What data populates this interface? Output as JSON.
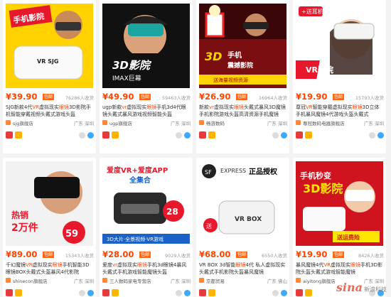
{
  "products": [
    {
      "price": "¥39.90",
      "badge": "包邮",
      "sales": "76286人收货",
      "title_pre": "SJG新款4代",
      "title_hl": "VR",
      "title_mid": "虚拟现实",
      "title_hl2": "眼镜",
      "title_post": "3D影院手机智能穿戴视频头戴式游戏头盔",
      "shop": "sjg旗舰店",
      "location": "广东 深圳",
      "thumb_text": "手机秘密影院",
      "thumb_brand": "VR SJG"
    },
    {
      "price": "¥49.90",
      "badge": "包邮",
      "sales": "59463人收货",
      "title_pre": "ugp新款",
      "title_hl": "vr",
      "title_mid": "虚拟现实",
      "title_hl2": "眼镜",
      "title_post": "手机3d4代眼镜头戴式暴风游戏视频智能头盔",
      "shop": "ugp旗舰店",
      "location": "广东 深圳",
      "thumb_text": "3D影院",
      "thumb_brand": "IMAX巨幕"
    },
    {
      "price": "¥26.90",
      "badge": "包邮",
      "sales": "16964人收货",
      "title_pre": "新款",
      "title_hl": "vr",
      "title_mid": "虚拟现实",
      "title_hl2": "眼镜",
      "title_post": "头戴式暴风3D魔镜手机影院游戏头盔高清资源手机魔镜",
      "shop": "畅游数码",
      "location": "广东 深圳",
      "thumb_text": "3D手机震撼影院",
      "thumb_brand": "送海量视频资源"
    },
    {
      "price": "¥19.90",
      "badge": "包邮",
      "sales": "15793人收货",
      "title_pre": "尊冠",
      "title_hl": "VR",
      "title_mid": "智能穿戴虚拟现实",
      "title_hl2": "眼镜",
      "title_post": "3D立体手机暴风魔镜4代游戏头盔头戴式",
      "shop": "尊冠数码电器旗舰店",
      "location": "广东 深圳",
      "thumb_text": "VR影院",
      "thumb_brand": "送耳机"
    },
    {
      "price": "¥89.00",
      "badge": "包邮",
      "sales": "15343人收货",
      "title_pre": "千幻魔镜",
      "title_hl": "VR",
      "title_mid": "虚拟现实",
      "title_hl2": "眼镜",
      "title_post": "手机智能3D眼镜BOX头戴式头盔暴风4代影院",
      "shop": "shinecon旗舰店",
      "location": "广东 深圳",
      "thumb_text": "热销2万件",
      "thumb_brand": "¥59"
    },
    {
      "price": "¥28.00",
      "badge": "包邮",
      "sales": "9029人收货",
      "title_pre": "爱度",
      "title_hl": "vr",
      "title_mid": "虚拟现实",
      "title_hl2": "眼镜",
      "title_post": "手机3d眼镜4暴风头戴式手机游戏智能魔镜头盔",
      "shop": "三人数码家电专营店",
      "location": "广东 深圳",
      "thumb_text": "爱度VR+爱度APP全集合",
      "thumb_brand": "3D大片·全景视频·VR游戏"
    },
    {
      "price": "¥68.00",
      "badge": "包邮",
      "sales": "6550人收货",
      "title_pre": "VR BOX 3d智能",
      "title_hl": "眼镜",
      "title_mid": "4代 私人虚拟现实",
      "title_hl2": "",
      "title_post": "头戴式手机影院头盔暴风魔镜",
      "shop": "京都贸易",
      "location": "广东 佛山",
      "thumb_text": "正品授权",
      "thumb_brand": "VR BOX"
    },
    {
      "price": "¥19.90",
      "badge": "包邮",
      "sales": "8426人收货",
      "title_pre": "暴风魔镜4代",
      "title_hl": "VR",
      "title_mid": "虚拟现实",
      "title_hl2": "眼镜",
      "title_post": "手机3D影院头盔头戴式游戏智能魔镜",
      "shop": "aiyitong旗舰店",
      "location": "广东 深圳",
      "thumb_text": "手机秒变3D影院",
      "thumb_brand": "送运费险"
    }
  ],
  "watermark": {
    "text": "sina",
    "sub": "新浪科技"
  },
  "colors": {
    "price": "#ff4400",
    "highlight": "#ff4400",
    "badge": "#ff6a1a"
  }
}
